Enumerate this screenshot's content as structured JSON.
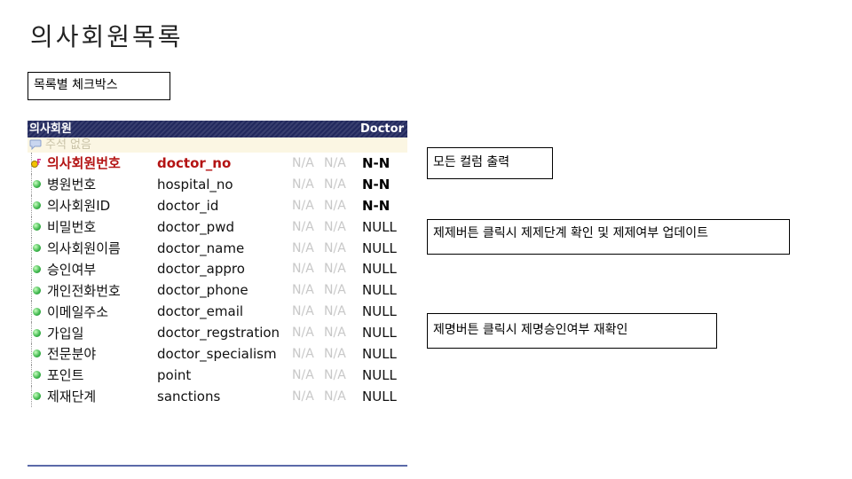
{
  "page": {
    "title": "의사회원목록"
  },
  "notes": {
    "checkbox": "목록별 체크박스",
    "columns": "모든 컬럼 출력",
    "sanction": "제제버튼 클릭시 제제단계 확인 및 제제여부 업데이트",
    "withdraw": "제명버튼 클릭시 제명승인여부 재확인"
  },
  "table": {
    "name": "의사회원",
    "english_name": "Doctor",
    "comment": "주석 없음",
    "rows": [
      {
        "label": "의사회원번호",
        "field": "doctor_no",
        "na1": "N/A",
        "na2": "N/A",
        "nullable": "N-N",
        "pk": true
      },
      {
        "label": "병원번호",
        "field": "hospital_no",
        "na1": "N/A",
        "na2": "N/A",
        "nullable": "N-N"
      },
      {
        "label": "의사회원ID",
        "field": "doctor_id",
        "na1": "N/A",
        "na2": "N/A",
        "nullable": "N-N"
      },
      {
        "label": "비밀번호",
        "field": "doctor_pwd",
        "na1": "N/A",
        "na2": "N/A",
        "nullable": "NULL"
      },
      {
        "label": "의사회원이름",
        "field": "doctor_name",
        "na1": "N/A",
        "na2": "N/A",
        "nullable": "NULL"
      },
      {
        "label": "승인여부",
        "field": "doctor_appro",
        "na1": "N/A",
        "na2": "N/A",
        "nullable": "NULL"
      },
      {
        "label": "개인전화번호",
        "field": "doctor_phone",
        "na1": "N/A",
        "na2": "N/A",
        "nullable": "NULL"
      },
      {
        "label": "이메일주소",
        "field": "doctor_email",
        "na1": "N/A",
        "na2": "N/A",
        "nullable": "NULL"
      },
      {
        "label": "가입일",
        "field": "doctor_regstration",
        "na1": "N/A",
        "na2": "N/A",
        "nullable": "NULL"
      },
      {
        "label": "전문분야",
        "field": "doctor_specialism",
        "na1": "N/A",
        "na2": "N/A",
        "nullable": "NULL"
      },
      {
        "label": "포인트",
        "field": "point",
        "na1": "N/A",
        "na2": "N/A",
        "nullable": "NULL"
      },
      {
        "label": "제재단계",
        "field": "sanctions",
        "na1": "N/A",
        "na2": "N/A",
        "nullable": "NULL"
      }
    ]
  },
  "icons": {
    "primary_key": "key-icon",
    "column": "column-dot-icon",
    "comment": "comment-icon"
  },
  "colors": {
    "header_bg": "#22295e",
    "pk_text": "#b41414",
    "comment_bg": "#fbf6e3",
    "na_text": "#c8c8c8"
  }
}
